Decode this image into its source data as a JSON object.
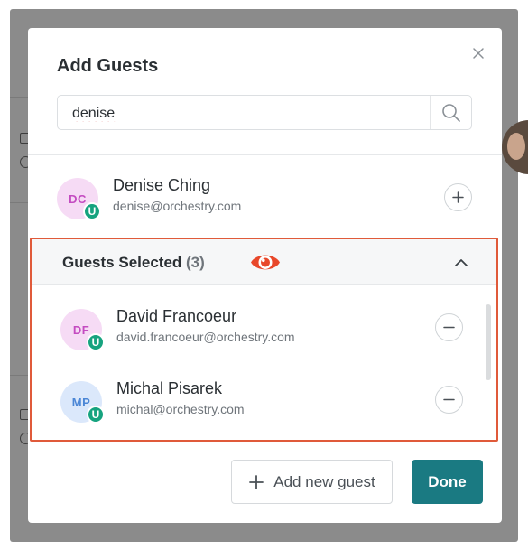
{
  "dialog": {
    "title": "Add Guests"
  },
  "search": {
    "value": "denise"
  },
  "search_results": [
    {
      "initials": "DC",
      "badge": "U",
      "name": "Denise Ching",
      "email": "denise@orchestry.com",
      "action": "add"
    }
  ],
  "guests_selected": {
    "title": "Guests Selected",
    "count": "(3)",
    "expanded": true,
    "items": [
      {
        "initials": "DF",
        "badge": "U",
        "name": "David Francoeur",
        "email": "david.francoeur@orchestry.com",
        "action": "remove"
      },
      {
        "initials": "MP",
        "badge": "U",
        "name": "Michal Pisarek",
        "email": "michal@orchestry.com",
        "action": "remove"
      }
    ]
  },
  "footer": {
    "add_new_guest_label": "Add new guest",
    "done_label": "Done"
  },
  "colors": {
    "accent": "#1a7a82",
    "user_badge": "#16a37f",
    "highlight_border": "#e05a3a",
    "avatar_pink_bg": "#f6dbf5",
    "avatar_blue_bg": "#dbe8fb"
  },
  "icons": {
    "close": "close-icon",
    "search": "search-icon",
    "add": "plus-icon",
    "remove": "minus-icon",
    "collapse": "chevron-up-icon",
    "visibility": "eye-icon"
  }
}
